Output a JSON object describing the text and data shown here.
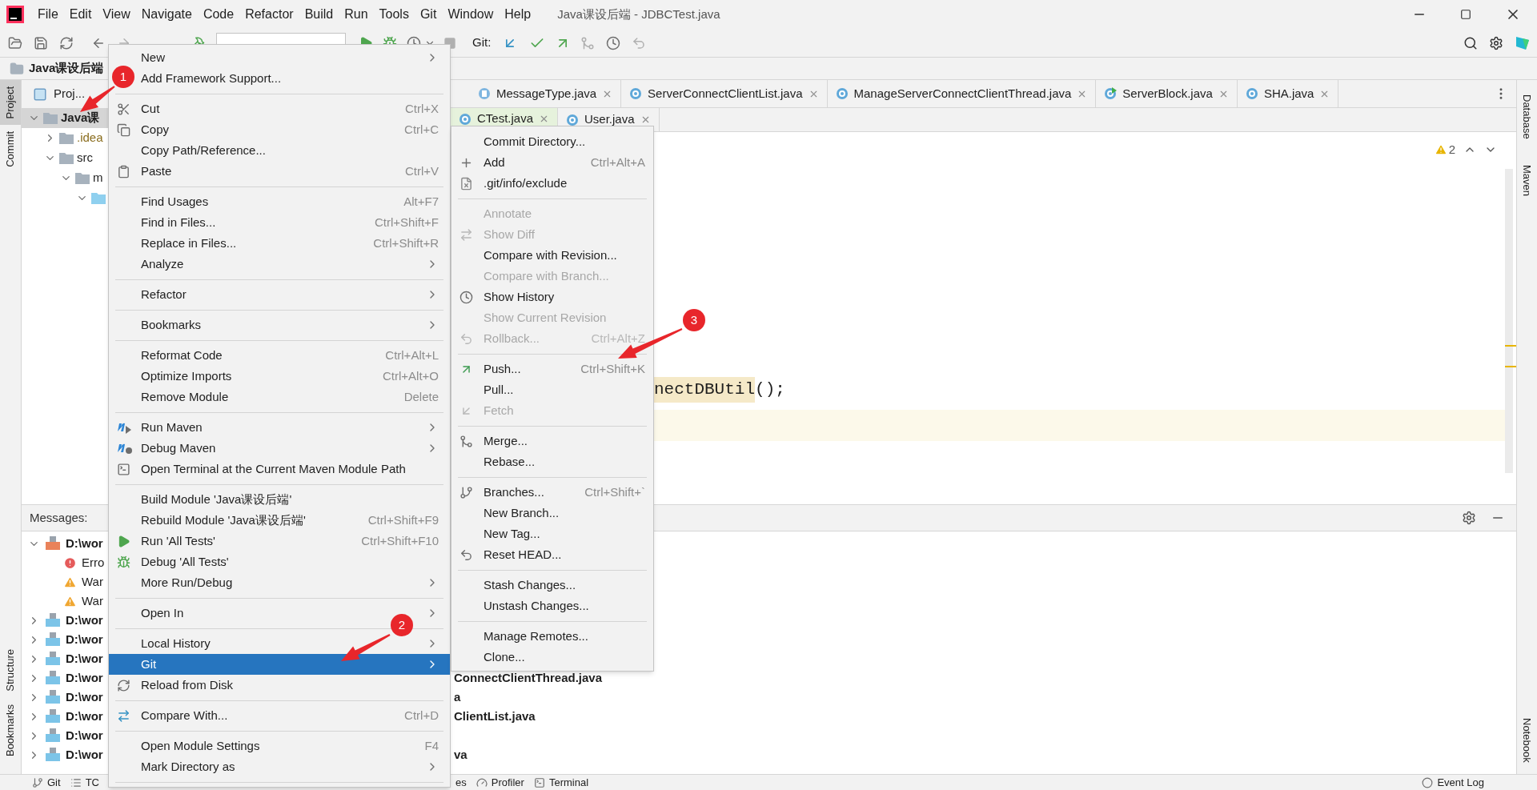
{
  "window": {
    "title": "Java课设后端 - JDBCTest.java"
  },
  "menu_bar": [
    "File",
    "Edit",
    "View",
    "Navigate",
    "Code",
    "Refactor",
    "Build",
    "Run",
    "Tools",
    "Git",
    "Window",
    "Help"
  ],
  "toolbar": {
    "git_label": "Git:"
  },
  "breadcrumb": "Java课设后端",
  "left_stripe": [
    {
      "label": "Project",
      "selected": true
    },
    {
      "label": "Commit",
      "selected": false
    },
    {
      "label": "Structure",
      "selected": false
    },
    {
      "label": "Bookmarks",
      "selected": false
    }
  ],
  "right_stripe": [
    {
      "label": "Database"
    },
    {
      "label": "Maven"
    },
    {
      "label": "Notebook"
    }
  ],
  "project_panel": {
    "title": "Proj...",
    "tree": [
      {
        "label": "Java课",
        "expanded": true,
        "selected": true,
        "children": [
          {
            "label": ".idea",
            "expanded": false,
            "selected": false
          },
          {
            "label": "src",
            "expanded": true,
            "selected": false,
            "children": [
              {
                "label": "m",
                "expanded": true,
                "selected": false,
                "children": [
                  {
                    "expanded": true,
                    "selected": false
                  }
                ]
              }
            ]
          }
        ]
      }
    ]
  },
  "editor_tabs": [
    [
      {
        "label": "MessageType.java",
        "kind": "enum",
        "selected": false
      },
      {
        "label": "ServerConnectClientList.java",
        "kind": "class",
        "selected": false
      },
      {
        "label": "ManageServerConnectClientThread.java",
        "kind": "class",
        "selected": false
      },
      {
        "label": "ServerBlock.java",
        "kind": "main_class",
        "selected": false
      },
      {
        "label": "SHA.java",
        "kind": "class",
        "selected": false
      }
    ],
    [
      {
        "label": "CTest.java",
        "kind": "class",
        "selected": true
      },
      {
        "label": "User.java",
        "kind": "class",
        "selected": false
      }
    ]
  ],
  "editor": {
    "warnings": "2",
    "code_highlighted": "nectDBUtil",
    "code_rest": "();"
  },
  "messages_panel": {
    "title": "Messages:",
    "rows": [
      {
        "kind": "xml",
        "label": "D:\\wor",
        "expanded": true,
        "children": [
          {
            "kind": "error",
            "label": "Erro"
          },
          {
            "kind": "warning",
            "label": "War"
          },
          {
            "kind": "warning",
            "label": "War"
          }
        ]
      },
      {
        "kind": "java",
        "label": "D:\\wor",
        "expanded": false
      },
      {
        "kind": "java",
        "label": "D:\\wor",
        "expanded": false
      },
      {
        "kind": "java",
        "label": "D:\\wor",
        "expanded": false
      },
      {
        "kind": "java",
        "label": "D:\\wor",
        "expanded": false,
        "tail": "ConnectClientThread.java"
      },
      {
        "kind": "java",
        "label": "D:\\wor",
        "expanded": false,
        "tail": "a"
      },
      {
        "kind": "java",
        "label": "D:\\wor",
        "expanded": false,
        "tail": "ClientList.java"
      },
      {
        "kind": "java",
        "label": "D:\\wor",
        "expanded": false
      },
      {
        "kind": "java",
        "label": "D:\\wor",
        "expanded": false,
        "tail": "va"
      }
    ]
  },
  "status_bar": {
    "left": [
      {
        "label": "Git",
        "kind": "git"
      },
      {
        "label": "TC",
        "kind": "list"
      }
    ],
    "middle": [
      {
        "label": "es",
        "kind": "none"
      },
      {
        "label": "Profiler",
        "kind": "profiler"
      },
      {
        "label": "Terminal",
        "kind": "terminal"
      }
    ],
    "right": [
      {
        "label": "Event Log",
        "kind": "log"
      }
    ]
  },
  "context_menu": {
    "items": [
      {
        "kind": "item",
        "label": "New",
        "submenu": true,
        "selected": false
      },
      {
        "kind": "item",
        "label": "Add Framework Support...",
        "selected": false
      },
      {
        "kind": "separator"
      },
      {
        "kind": "item",
        "label": "Cut",
        "shortcut": "Ctrl+X",
        "selected": false
      },
      {
        "kind": "item",
        "label": "Copy",
        "shortcut": "Ctrl+C",
        "selected": false
      },
      {
        "kind": "item",
        "label": "Copy Path/Reference...",
        "selected": false
      },
      {
        "kind": "item",
        "label": "Paste",
        "shortcut": "Ctrl+V",
        "selected": false
      },
      {
        "kind": "separator"
      },
      {
        "kind": "item",
        "label": "Find Usages",
        "shortcut": "Alt+F7",
        "selected": false
      },
      {
        "kind": "item",
        "label": "Find in Files...",
        "shortcut": "Ctrl+Shift+F",
        "selected": false
      },
      {
        "kind": "item",
        "label": "Replace in Files...",
        "shortcut": "Ctrl+Shift+R",
        "selected": false
      },
      {
        "kind": "item",
        "label": "Analyze",
        "submenu": true,
        "selected": false
      },
      {
        "kind": "separator"
      },
      {
        "kind": "item",
        "label": "Refactor",
        "submenu": true,
        "selected": false
      },
      {
        "kind": "separator"
      },
      {
        "kind": "item",
        "label": "Bookmarks",
        "submenu": true,
        "selected": false
      },
      {
        "kind": "separator"
      },
      {
        "kind": "item",
        "label": "Reformat Code",
        "shortcut": "Ctrl+Alt+L",
        "selected": false
      },
      {
        "kind": "item",
        "label": "Optimize Imports",
        "shortcut": "Ctrl+Alt+O",
        "selected": false
      },
      {
        "kind": "item",
        "label": "Remove Module",
        "shortcut": "Delete",
        "selected": false
      },
      {
        "kind": "separator"
      },
      {
        "kind": "item",
        "label": "Run Maven",
        "submenu": true,
        "selected": false
      },
      {
        "kind": "item",
        "label": "Debug Maven",
        "submenu": true,
        "selected": false
      },
      {
        "kind": "item",
        "label": "Open Terminal at the Current Maven Module Path",
        "selected": false
      },
      {
        "kind": "separator"
      },
      {
        "kind": "item",
        "label": "Build Module 'Java课设后端'",
        "selected": false
      },
      {
        "kind": "item",
        "label": "Rebuild Module 'Java课设后端'",
        "shortcut": "Ctrl+Shift+F9",
        "selected": false
      },
      {
        "kind": "item",
        "label": "Run 'All Tests'",
        "shortcut": "Ctrl+Shift+F10",
        "selected": false
      },
      {
        "kind": "item",
        "label": "Debug 'All Tests'",
        "selected": false
      },
      {
        "kind": "item",
        "label": "More Run/Debug",
        "submenu": true,
        "selected": false
      },
      {
        "kind": "separator"
      },
      {
        "kind": "item",
        "label": "Open In",
        "submenu": true,
        "selected": false
      },
      {
        "kind": "separator"
      },
      {
        "kind": "item",
        "label": "Local History",
        "submenu": true,
        "selected": false
      },
      {
        "kind": "item",
        "label": "Git",
        "submenu": true,
        "selected": true
      },
      {
        "kind": "item",
        "label": "Reload from Disk",
        "selected": false
      },
      {
        "kind": "separator"
      },
      {
        "kind": "item",
        "label": "Compare With...",
        "shortcut": "Ctrl+D",
        "selected": false
      },
      {
        "kind": "separator"
      },
      {
        "kind": "item",
        "label": "Open Module Settings",
        "shortcut": "F4",
        "selected": false
      },
      {
        "kind": "item",
        "label": "Mark Directory as",
        "submenu": true,
        "selected": false
      },
      {
        "kind": "separator"
      }
    ]
  },
  "git_submenu": {
    "items": [
      {
        "kind": "item",
        "label": "Commit Directory...",
        "disabled": false
      },
      {
        "kind": "item",
        "label": "Add",
        "shortcut": "Ctrl+Alt+A",
        "disabled": false
      },
      {
        "kind": "item",
        "label": ".git/info/exclude",
        "disabled": false
      },
      {
        "kind": "separator"
      },
      {
        "kind": "item",
        "label": "Annotate",
        "disabled": true
      },
      {
        "kind": "item",
        "label": "Show Diff",
        "disabled": true
      },
      {
        "kind": "item",
        "label": "Compare with Revision...",
        "disabled": false
      },
      {
        "kind": "item",
        "label": "Compare with Branch...",
        "disabled": true
      },
      {
        "kind": "item",
        "label": "Show History",
        "disabled": false
      },
      {
        "kind": "item",
        "label": "Show Current Revision",
        "disabled": true
      },
      {
        "kind": "item",
        "label": "Rollback...",
        "shortcut": "Ctrl+Alt+Z",
        "disabled": true
      },
      {
        "kind": "separator"
      },
      {
        "kind": "item",
        "label": "Push...",
        "shortcut": "Ctrl+Shift+K",
        "disabled": false
      },
      {
        "kind": "item",
        "label": "Pull...",
        "disabled": false
      },
      {
        "kind": "item",
        "label": "Fetch",
        "disabled": true
      },
      {
        "kind": "separator"
      },
      {
        "kind": "item",
        "label": "Merge...",
        "disabled": false
      },
      {
        "kind": "item",
        "label": "Rebase...",
        "disabled": false
      },
      {
        "kind": "separator"
      },
      {
        "kind": "item",
        "label": "Branches...",
        "shortcut": "Ctrl+Shift+`",
        "disabled": false
      },
      {
        "kind": "item",
        "label": "New Branch...",
        "disabled": false
      },
      {
        "kind": "item",
        "label": "New Tag...",
        "disabled": false
      },
      {
        "kind": "item",
        "label": "Reset HEAD...",
        "disabled": false
      },
      {
        "kind": "separator"
      },
      {
        "kind": "item",
        "label": "Stash Changes...",
        "disabled": false
      },
      {
        "kind": "item",
        "label": "Unstash Changes...",
        "disabled": false
      },
      {
        "kind": "separator"
      },
      {
        "kind": "item",
        "label": "Manage Remotes...",
        "disabled": false
      },
      {
        "kind": "item",
        "label": "Clone...",
        "disabled": false
      }
    ]
  },
  "annotations": [
    {
      "label": "1"
    },
    {
      "label": "2"
    },
    {
      "label": "3"
    }
  ]
}
